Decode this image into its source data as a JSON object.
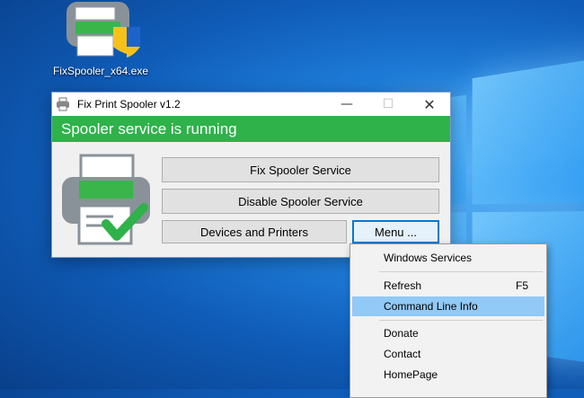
{
  "desktop": {
    "icon_label": "FixSpooler_x64.exe"
  },
  "window": {
    "title": "Fix Print Spooler v1.2",
    "minimize_glyph": "—",
    "maximize_glyph": "☐",
    "close_glyph": "✕",
    "status_text": "Spooler service is running",
    "buttons": {
      "fix": "Fix Spooler Service",
      "disable": "Disable Spooler Service",
      "devices": "Devices and Printers",
      "menu": "Menu ..."
    }
  },
  "context_menu": {
    "items": [
      {
        "label": "Windows Services",
        "shortcut": ""
      },
      {
        "label": "Refresh",
        "shortcut": "F5"
      },
      {
        "label": "Command Line Info",
        "shortcut": ""
      },
      {
        "label": "Donate",
        "shortcut": ""
      },
      {
        "label": "Contact",
        "shortcut": ""
      },
      {
        "label": "HomePage",
        "shortcut": ""
      }
    ]
  },
  "colors": {
    "status_green": "#2fb24a",
    "highlight": "#91c9f7",
    "focus_border": "#0078d7"
  },
  "icons": [
    "printer-check-icon",
    "shield-icon",
    "app-printer-icon"
  ]
}
